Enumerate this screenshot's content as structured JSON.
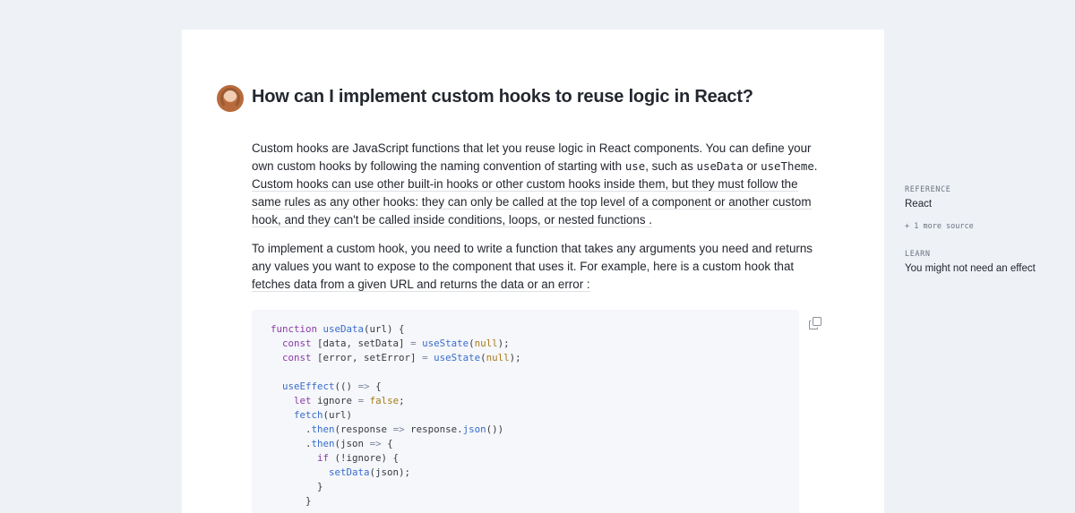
{
  "question": {
    "text": "How can I implement custom hooks to reuse logic in React?"
  },
  "answer": {
    "p1": {
      "l1": "Custom hooks are JavaScript functions that let you reuse logic in React components. You can define your",
      "l2a": "own custom hooks by following the naming convention of starting with ",
      "l2code1": "use",
      "l2b": ", such as ",
      "l2code2": "useData",
      "l2c": " or ",
      "l2code3": "useTheme",
      "l2d": ".",
      "l3": "Custom hooks can use other built-in hooks or other custom hooks inside them, but they must follow the",
      "l4": "same rules as any other hooks: they can only be called at the top level of a component or another custom",
      "l5": "hook, and they can't be called inside conditions, loops, or nested functions ."
    },
    "p2": {
      "l1": "To implement a custom hook, you need to write a function that takes any arguments you need and returns",
      "l2": "any values you want to expose to the component that uses it. For example, here is a custom hook that",
      "l3": "fetches data from a given URL and returns the data or an error :"
    }
  },
  "code": {
    "kw_function": "function",
    "fn_useData": "useData",
    "t_url_open": "(url) {",
    "kw_const": "const",
    "t_data_destr": "[data, setData]",
    "op_eq": "=",
    "fn_useState": "useState",
    "lit_null": "null",
    "t_error_destr": "[error, setError]",
    "fn_useEffect": "useEffect",
    "t_arrow_params": "(()",
    "op_arrow": "=>",
    "t_brace_open": "{",
    "kw_let": "let",
    "t_ignore": "ignore",
    "lit_false": "false",
    "fn_fetch": "fetch",
    "t_url_call": "(url)",
    "fn_then": "then",
    "t_response": "response",
    "fn_json": "json",
    "t_json_param": "json",
    "kw_if": "if",
    "t_not_ignore": "(!ignore) {",
    "fn_setData": "setData",
    "t_json_call": "(json);",
    "t_close_brace": "}"
  },
  "sidebar": {
    "reference_label": "REFERENCE",
    "reference_title": "React",
    "more_sources": "+ 1 more source",
    "learn_label": "LEARN",
    "learn_title": "You might not need an effect"
  },
  "icons": {
    "avatar": "user-avatar",
    "copy": "copy-icon"
  },
  "colors": {
    "page_bg": "#eef1f6",
    "card_bg": "#ffffff",
    "code_bg": "#f5f7fa",
    "keyword": "#8a3aa8",
    "function": "#3a6ccc",
    "literal": "#a87a1a"
  }
}
